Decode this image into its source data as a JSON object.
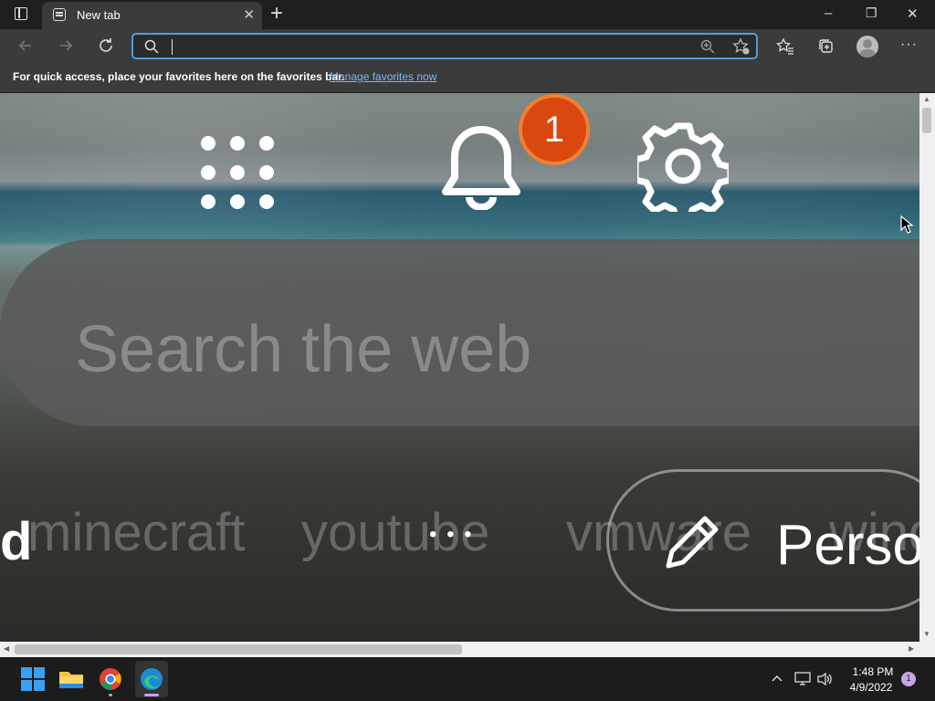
{
  "tab": {
    "title": "New tab",
    "close": "✕",
    "new_tab": "+"
  },
  "window_controls": {
    "minimize": "–",
    "restore": "❐",
    "close": "✕"
  },
  "address": {
    "value": "",
    "placeholder": ""
  },
  "favorites_bar": {
    "text": "For quick access, place your favorites here on the favorites bar.",
    "link": "Manage favorites now"
  },
  "newtab": {
    "notification_count": "1",
    "search_placeholder": "Search the web",
    "quick_links": [
      "minecraft",
      "youtube",
      "vmware",
      "wind"
    ],
    "left_fragment": "d",
    "personalize_fragment": "Perso",
    "more": "• • •"
  },
  "taskbar": {
    "time": "1:48 PM",
    "date": "4/9/2022",
    "notifications": "1"
  },
  "colors": {
    "accent": "#5a9bd5",
    "badge": "#d9480f",
    "link": "#7fb3ff"
  }
}
